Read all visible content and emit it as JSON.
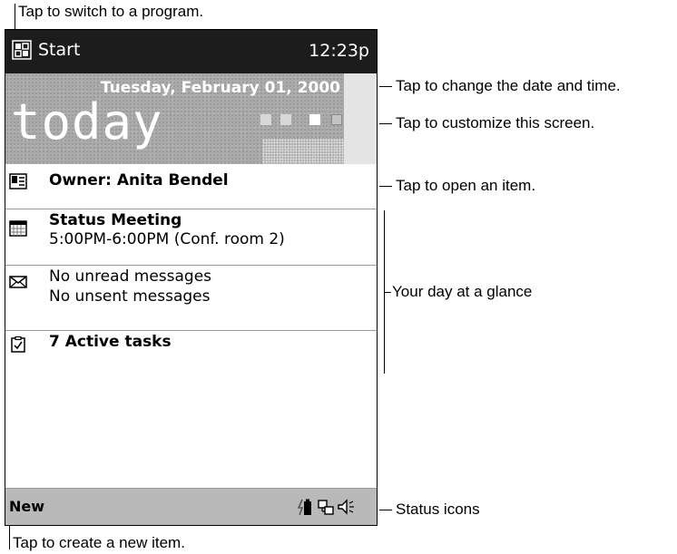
{
  "callouts": {
    "switch_program": "Tap to switch to a program.",
    "change_date_time": "Tap to change the date and time.",
    "customize_screen": "Tap to customize this screen.",
    "open_item": "Tap to open an item.",
    "day_at_glance": "Your day at a glance",
    "status_icons": "Status icons",
    "create_new_item": "Tap to create a new item."
  },
  "taskbar": {
    "start_label": "Start",
    "clock": "12:23p"
  },
  "today": {
    "date": "Tuesday, February 01, 2000",
    "title": "today"
  },
  "items": {
    "owner": "Owner: Anita Bendel",
    "meeting_title": "Status Meeting",
    "meeting_detail": "5:00PM-6:00PM (Conf. room 2)",
    "inbox_unread": "No unread messages",
    "inbox_unsent": "No unsent messages",
    "tasks": "7 Active tasks"
  },
  "command_bar": {
    "new_label": "New"
  },
  "icons": {
    "start": "windows-flag-icon",
    "owner": "contact-card-icon",
    "calendar": "calendar-icon",
    "inbox": "envelope-icon",
    "tasks": "task-check-icon",
    "power": "battery-icon",
    "connection": "connection-icon",
    "volume": "speaker-icon"
  },
  "colors": {
    "taskbar": "#1c1c1c",
    "banner": "#a9a9a9",
    "command_bar": "#b9b9b9"
  }
}
